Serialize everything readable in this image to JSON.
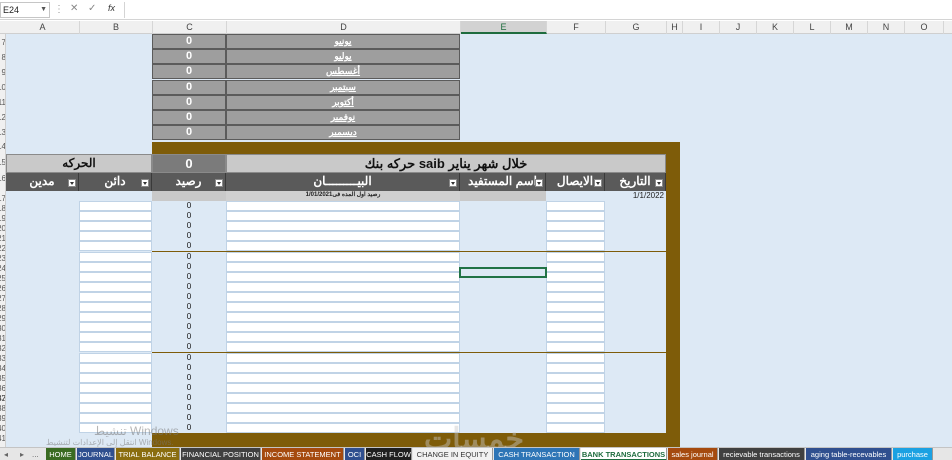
{
  "formula_bar": {
    "name_box": "E24",
    "fx": "fx",
    "cancel": "✕",
    "enter": "✓"
  },
  "columns": [
    "A",
    "B",
    "C",
    "D",
    "E",
    "F",
    "G",
    "H",
    "I",
    "J",
    "K",
    "L",
    "M",
    "N",
    "O"
  ],
  "selected_column": "E",
  "row_numbers": [
    "",
    "7",
    "8",
    "9",
    "10",
    "11",
    "12",
    "13",
    "14",
    "15",
    "16",
    "17",
    "18",
    "19",
    "20",
    "21",
    "22",
    "23",
    "24",
    "25",
    "26",
    "27",
    "28",
    "29",
    "30",
    "31",
    "32",
    "33",
    "34",
    "35",
    "36",
    "37",
    "38",
    "39",
    "40",
    "41",
    "42"
  ],
  "months": [
    {
      "value": "0",
      "name": "يونيو"
    },
    {
      "value": "0",
      "name": "يوليو"
    },
    {
      "value": "0",
      "name": "أغسطس"
    },
    {
      "value": "0",
      "name": "سبتمبر"
    },
    {
      "value": "0",
      "name": "أكتوبر"
    },
    {
      "value": "0",
      "name": "نوفمبر"
    },
    {
      "value": "0",
      "name": "ديسمبر"
    }
  ],
  "banner": {
    "movement_label": "الحركه",
    "balance_value": "0",
    "title": "حركه بنك saib خلال شهر يناير"
  },
  "headers": {
    "debit": "مدين",
    "credit": "دائن",
    "balance": "رصيد",
    "description": "البيـــــــــان",
    "beneficiary": "اسم المستفيد",
    "receipt": "الايصال",
    "date": "التاريخ"
  },
  "opening_row": {
    "description": "رصيد اول المده فى1/01/2021",
    "date": "1/1/2022"
  },
  "balances": [
    "0",
    "0",
    "0",
    "0",
    "0",
    "0",
    "0",
    "0",
    "0",
    "0",
    "0",
    "0",
    "0",
    "0",
    "0",
    "0",
    "0",
    "0",
    "0",
    "0",
    "0",
    "0",
    "0"
  ],
  "watermark": {
    "line1": "تنشيط Windows",
    "line2": "انتقل إلى الإعدادات لتنشيط Windows.",
    "line3": "خمسات"
  },
  "sheet_tabs": [
    {
      "label": "HOME",
      "bg": "#3a6b22",
      "fg": "#ffffff"
    },
    {
      "label": "JOURNAL",
      "bg": "#2f4f8f",
      "fg": "#ffffff"
    },
    {
      "label": "TRIAL BALANCE",
      "bg": "#8a6d0f",
      "fg": "#ffffff"
    },
    {
      "label": "FINANCIAL POSITION",
      "bg": "#404040",
      "fg": "#ffffff"
    },
    {
      "label": "INCOME STATEMENT",
      "bg": "#a54a0e",
      "fg": "#ffffff"
    },
    {
      "label": "OCI",
      "bg": "#2f4f8f",
      "fg": "#ffffff"
    },
    {
      "label": "CASH FLOW",
      "bg": "#1f1f1f",
      "fg": "#ffffff"
    },
    {
      "label": "CHANGE IN EQUITY",
      "bg": "#f2f2f2",
      "fg": "#333333"
    },
    {
      "label": "CASH TRANSACTION",
      "bg": "#2e75b6",
      "fg": "#ffffff"
    },
    {
      "label": "BANK TRANSACTIONS",
      "bg": "#ffffff",
      "fg": "#1e6c3e",
      "active": true
    },
    {
      "label": "sales journal",
      "bg": "#a54a0e",
      "fg": "#ffffff"
    },
    {
      "label": "recievable transactions",
      "bg": "#404040",
      "fg": "#ffffff"
    },
    {
      "label": "aging table-recevables",
      "bg": "#2f4f8f",
      "fg": "#ffffff"
    },
    {
      "label": "purchase",
      "bg": "#1ba1e2",
      "fg": "#ffffff"
    }
  ],
  "nav": {
    "prev": "◂",
    "next": "▸",
    "more": "..."
  }
}
